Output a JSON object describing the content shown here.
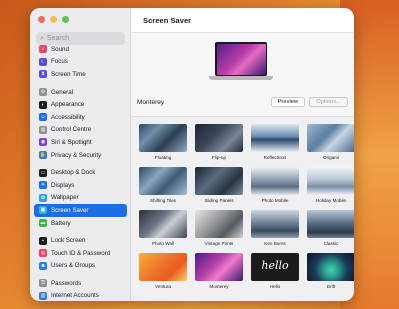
{
  "window": {
    "title": "Screen Saver"
  },
  "sidebar": {
    "search_placeholder": "Search",
    "groups": [
      [
        {
          "label": "Sound",
          "icon": "sound-icon",
          "color": "#e8456a",
          "glyph": "♪"
        },
        {
          "label": "Focus",
          "icon": "focus-moon-icon",
          "color": "#5b4dd6",
          "glyph": "☾"
        },
        {
          "label": "Screen Time",
          "icon": "hourglass-icon",
          "color": "#5b4dd6",
          "glyph": "⧗"
        }
      ],
      [
        {
          "label": "General",
          "icon": "gear-icon",
          "color": "#8e8e93",
          "glyph": "⚙"
        },
        {
          "label": "Appearance",
          "icon": "appearance-icon",
          "color": "#1d1d1f",
          "glyph": "◐"
        },
        {
          "label": "Accessibility",
          "icon": "accessibility-icon",
          "color": "#1d6ee6",
          "glyph": "☺"
        },
        {
          "label": "Control Centre",
          "icon": "control-centre-icon",
          "color": "#8e8e93",
          "glyph": "▤"
        },
        {
          "label": "Siri & Spotlight",
          "icon": "siri-icon",
          "color": "#7b3fd6",
          "glyph": "◉"
        },
        {
          "label": "Privacy & Security",
          "icon": "hand-icon",
          "color": "#2b7de9",
          "glyph": "✋"
        }
      ],
      [
        {
          "label": "Desktop & Dock",
          "icon": "desktop-dock-icon",
          "color": "#1d1d1f",
          "glyph": "▭"
        },
        {
          "label": "Displays",
          "icon": "displays-icon",
          "color": "#1d6ee6",
          "glyph": "☀"
        },
        {
          "label": "Wallpaper",
          "icon": "wallpaper-icon",
          "color": "#31a3e8",
          "glyph": "✿"
        },
        {
          "label": "Screen Saver",
          "icon": "screen-saver-icon",
          "color": "#31b5d8",
          "glyph": "▣",
          "active": true
        },
        {
          "label": "Battery",
          "icon": "battery-icon",
          "color": "#3bb54a",
          "glyph": "▬"
        }
      ],
      [
        {
          "label": "Lock Screen",
          "icon": "lock-icon",
          "color": "#1d1d1f",
          "glyph": "▪"
        },
        {
          "label": "Touch ID & Password",
          "icon": "fingerprint-icon",
          "color": "#e8456a",
          "glyph": "◎"
        },
        {
          "label": "Users & Groups",
          "icon": "users-icon",
          "color": "#2b7de9",
          "glyph": "☻"
        }
      ],
      [
        {
          "label": "Passwords",
          "icon": "key-icon",
          "color": "#8e8e93",
          "glyph": "⚿"
        },
        {
          "label": "Internet Accounts",
          "icon": "at-icon",
          "color": "#2b7de9",
          "glyph": "@"
        }
      ]
    ]
  },
  "preview": {
    "current_name": "Monterey",
    "preview_button": "Preview",
    "options_button": "Options..."
  },
  "savers": [
    {
      "name": "Floating",
      "style": "linear-gradient(135deg,#2c4a6a 0%,#6f8ea8 30%,#2c3e52 60%,#8ea9bf 100%)"
    },
    {
      "name": "Flip-up",
      "style": "linear-gradient(135deg,#1c2533 0%,#3a4658 40%,#7a8597 70%,#222a36 100%)"
    },
    {
      "name": "Reflections",
      "style": "linear-gradient(180deg,#dfe6ee 0%,#6a8bb0 45%,#2e4a6e 55%,#e8eef4 100%)"
    },
    {
      "name": "Origami",
      "style": "linear-gradient(135deg,#9fb8cc 0%,#5a7fa1 40%,#c6d6e2 60%,#48698a 100%)"
    },
    {
      "name": "Shifting Tiles",
      "style": "linear-gradient(135deg,#2f4660 0%,#8aa7bf 35%,#3d5a77 60%,#a8bfd0 100%)"
    },
    {
      "name": "Sliding Panels",
      "style": "linear-gradient(135deg,#1b2433 0%,#5a6b80 40%,#2a3444 70%,#7d8da0 100%)"
    },
    {
      "name": "Photo Mobile",
      "style": "linear-gradient(180deg,#eef1f4 0%,#9aa7b6 40%,#5c6f85 70%,#e2e7ec 100%)"
    },
    {
      "name": "Holiday Mobile",
      "style": "linear-gradient(180deg,#f3f5f8 0%,#b9c6d4 45%,#7a90a8 70%,#eef2f6 100%)"
    },
    {
      "name": "Photo Wall",
      "style": "linear-gradient(135deg,#2a2f38 0%,#6b7584 40%,#c9cfd6 60%,#3c4450 100%)"
    },
    {
      "name": "Vintage Prints",
      "style": "linear-gradient(135deg,#e8e6e0 0%,#9a9d9f 40%,#545a61 70%,#d4d3ce 100%)"
    },
    {
      "name": "Ken Burns",
      "style": "linear-gradient(180deg,#cdd7e0 0%,#6f8296 45%,#384a5e 75%,#8fa1b2 100%)"
    },
    {
      "name": "Classic",
      "style": "linear-gradient(180deg,#b9c7d5 0%,#52687f 50%,#2d3d50 80%,#6d8095 100%)"
    },
    {
      "name": "Ventura",
      "style": "linear-gradient(135deg,#f6b13a 0%,#f07a2c 40%,#e85a1e 70%,#fbd16a 100%)"
    },
    {
      "name": "Monterey",
      "style": "linear-gradient(135deg,#4a1a86 0%,#b33fa8 40%,#ef79c9 60%,#3a1670 100%)"
    },
    {
      "name": "Hello",
      "style": "#1b1b1d",
      "overlay_text": "hello"
    },
    {
      "name": "Drift",
      "style": "radial-gradient(circle at 50% 60%,#3fd6b0 0%,#2b9c8e 25%,#1a3a5a 55%,#0d1524 100%)"
    }
  ]
}
